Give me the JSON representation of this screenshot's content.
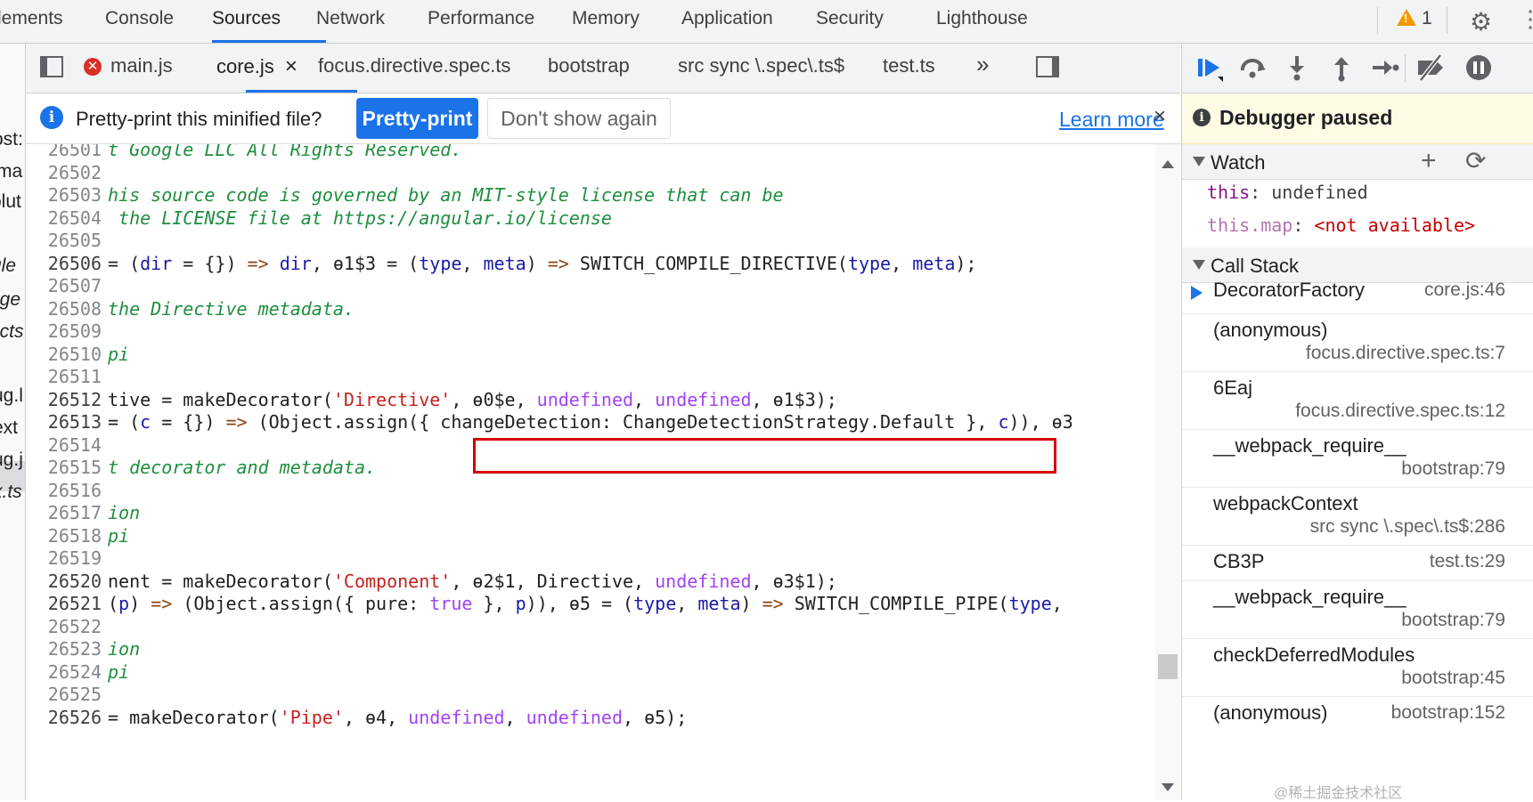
{
  "top_tabs": [
    "lements",
    "Console",
    "Sources",
    "Network",
    "Performance",
    "Memory",
    "Application",
    "Security",
    "Lighthouse"
  ],
  "warnings_count": "1",
  "file_tabs": [
    "main.js",
    "core.js",
    "focus.directive.spec.ts",
    "bootstrap",
    "src sync \\.spec\\.ts$",
    "test.ts"
  ],
  "file_tabs_more": "»",
  "close_glyph": "×",
  "navigator_fragments": [
    "ost:",
    "ma",
    "olut",
    "ule",
    "age",
    "ects",
    "ug.l",
    "ext",
    "ug.j",
    "x.ts"
  ],
  "infobar": {
    "message": "Pretty-print this minified file?",
    "pretty_print_label": "Pretty-print",
    "dont_show_label": "Don't show again",
    "learn_more_label": "Learn more"
  },
  "code_lines": [
    {
      "n": "26501",
      "src": "t Google LLC All Rights Reserved."
    },
    {
      "n": "26502",
      "src": ""
    },
    {
      "n": "26503",
      "src": "his source code is governed by an MIT-style license that can be"
    },
    {
      "n": "26504",
      "src": " the LICENSE file at https://angular.io/license"
    },
    {
      "n": "26505",
      "src": ""
    },
    {
      "n": "26506",
      "src": "= (dir = {}) => dir, ɵ1$3 = (type, meta) => SWITCH_COMPILE_DIRECTIVE(type, meta);"
    },
    {
      "n": "26507",
      "src": ""
    },
    {
      "n": "26508",
      "src": "the Directive metadata."
    },
    {
      "n": "26509",
      "src": ""
    },
    {
      "n": "26510",
      "src": "pi"
    },
    {
      "n": "26511",
      "src": ""
    },
    {
      "n": "26512",
      "src": "tive = makeDecorator('Directive', ɵ0$e, undefined, undefined, ɵ1$3);"
    },
    {
      "n": "26513",
      "src": "= (c = {}) => (Object.assign({ changeDetection: ChangeDetectionStrategy.Default }, c)), ɵ3"
    },
    {
      "n": "26514",
      "src": ""
    },
    {
      "n": "26515",
      "src": "t decorator and metadata."
    },
    {
      "n": "26516",
      "src": ""
    },
    {
      "n": "26517",
      "src": "ion"
    },
    {
      "n": "26518",
      "src": "pi"
    },
    {
      "n": "26519",
      "src": ""
    },
    {
      "n": "26520",
      "src": "nent = makeDecorator('Component', ɵ2$1, Directive, undefined, ɵ3$1);"
    },
    {
      "n": "26521",
      "src": "(p) => (Object.assign({ pure: true }, p)), ɵ5 = (type, meta) => SWITCH_COMPILE_PIPE(type,"
    },
    {
      "n": "26522",
      "src": ""
    },
    {
      "n": "26523",
      "src": "ion"
    },
    {
      "n": "26524",
      "src": "pi"
    },
    {
      "n": "26525",
      "src": ""
    },
    {
      "n": "26526",
      "src": "= makeDecorator('Pipe', ɵ4, undefined, undefined, ɵ5);"
    }
  ],
  "debugger": {
    "paused_label": "Debugger paused",
    "watch_title": "Watch",
    "watch": [
      {
        "key": "this",
        "sep": ": ",
        "value": "undefined"
      },
      {
        "key": "this.map",
        "sep": ": ",
        "value": "<not available>"
      }
    ],
    "callstack_title": "Call Stack",
    "frames": [
      {
        "name": "DecoratorFactory",
        "loc": "core.js:46"
      },
      {
        "name": "(anonymous)",
        "loc": "focus.directive.spec.ts:7"
      },
      {
        "name": "6Eaj",
        "loc": "focus.directive.spec.ts:12"
      },
      {
        "name": "__webpack_require__",
        "loc": "bootstrap:79"
      },
      {
        "name": "webpackContext",
        "loc": "src sync \\.spec\\.ts$:286"
      },
      {
        "name": "CB3P",
        "loc": "test.ts:29"
      },
      {
        "name": "__webpack_require__",
        "loc": "bootstrap:79"
      },
      {
        "name": "checkDeferredModules",
        "loc": "bootstrap:45"
      },
      {
        "name": "(anonymous)",
        "loc": "bootstrap:152"
      }
    ]
  },
  "watermark": "@稀土掘金技术社区",
  "colors": {
    "accent": "#1a73e8",
    "highlight_box": "#d50000",
    "paused_bg": "#fffbe5",
    "error": "#d93025"
  }
}
